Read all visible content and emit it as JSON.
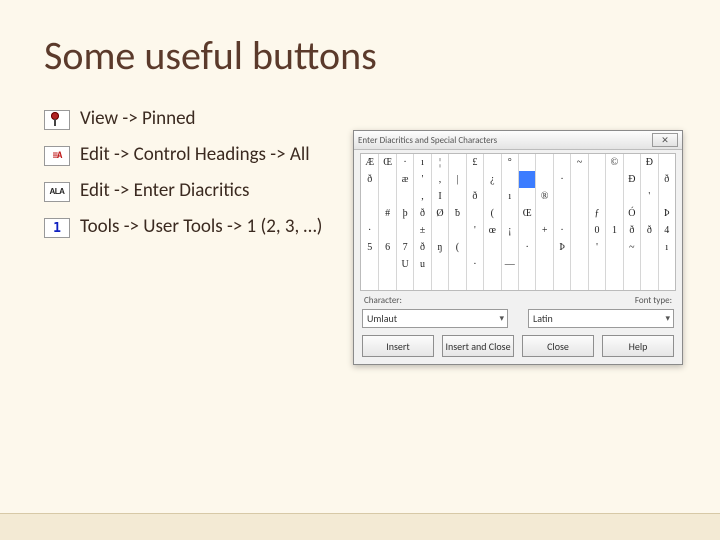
{
  "title": "Some useful buttons",
  "bullets": [
    {
      "text": "View -> Pinned"
    },
    {
      "text": "Edit -> Control Headings -> All"
    },
    {
      "text": "Edit -> Enter Diacritics"
    },
    {
      "text": "Tools -> User Tools -> 1 (2, 3, …)"
    }
  ],
  "dialog": {
    "title": "Enter Diacritics and Special Characters",
    "close_label": "✕",
    "section_left_label": "Character:",
    "section_right_label": "Font type:",
    "dropdown_left_value": "Umlaut",
    "dropdown_right_value": "Latin",
    "buttons": {
      "insert": "Insert",
      "insert_close": "Insert and Close",
      "close": "Close",
      "help": "Help"
    },
    "grid_glyphs": [
      "Æ",
      "Œ",
      "·",
      "ı",
      "¦",
      "£",
      "°",
      "",
      "~",
      "©",
      "Đ",
      "ð",
      "",
      "æ",
      "'",
      ",",
      "|",
      "¿",
      "",
      "·",
      "",
      "Đ",
      "ð",
      "",
      "",
      "",
      ",",
      "I",
      "ð",
      "ı",
      "®",
      "",
      "",
      "'",
      "",
      "#",
      "þ",
      "ð",
      "Ø",
      "ƀ",
      "(",
      "Œ",
      "",
      "ƒ",
      "Ó",
      "Þ",
      "·",
      "",
      "",
      "±",
      "",
      "",
      "'",
      "œ",
      "¡",
      "",
      "+",
      "·",
      "",
      "0",
      "1",
      "ð",
      "ð",
      "4",
      "5",
      "6",
      "7",
      "ð",
      "ŋ",
      "(",
      "",
      "·",
      "Þ",
      "'",
      "~",
      "ı",
      "",
      "",
      "U",
      "u",
      "",
      "·",
      "—"
    ]
  },
  "icons": {
    "ctrl_text": "≡A",
    "ala_text": "ALA",
    "one_text": "1"
  }
}
